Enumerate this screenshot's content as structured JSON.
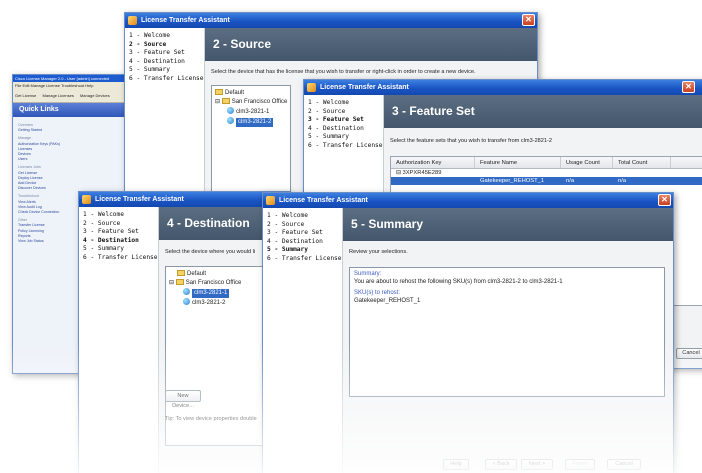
{
  "clm": {
    "title": "Cisco License Manager 2.0 - User [admin] connected",
    "menu": "File  Edit  Manage  License  Troubleshoot  Help",
    "toolbar": [
      "Get License",
      "Manage Licenses",
      "Manage Devices"
    ],
    "quick_links_title": "Quick Links",
    "links": [
      "Overview",
      "Getting Started",
      "Manage",
      "Authorization Keys (PAKs)",
      "Licenses",
      "Devices",
      "Users",
      "Licenses Jobs",
      "Get License",
      "Deploy License",
      "Add Device",
      "Discover Devices",
      "Troubleshoot",
      "View Alerts",
      "View Audit Log",
      "Check Device Connection",
      "Other",
      "Transfer License",
      "Policy Licensing",
      "Reports",
      "View Job Status"
    ]
  },
  "wizard_title": "License Transfer Assistant",
  "steps": [
    "1 - Welcome",
    "2 - Source",
    "3 - Feature Set",
    "4 - Destination",
    "5 - Summary",
    "6 - Transfer License"
  ],
  "source": {
    "heading": "2 - Source",
    "instruction": "Select the device that has the license that you wish to transfer or right-click in order to create a new device.",
    "tree": [
      "Default",
      "San Francisco Office",
      "clm3-2821-1",
      "clm3-2821-2"
    ]
  },
  "feature": {
    "heading": "3 - Feature Set",
    "instruction": "Select the feature sets that you wish to transfer from clm3-2821-2",
    "columns": [
      "Authorization Key",
      "Feature Name",
      "Usage Count",
      "Total Count"
    ],
    "group_key": "3XPXR45E289",
    "row": {
      "feature": "Gatekeeper_REHOST_1",
      "usage": "n/a",
      "total": "n/a"
    },
    "cancel": "Cancel"
  },
  "destination": {
    "heading": "4 - Destination",
    "instruction": "Select the device where you would li",
    "tree": [
      "Default",
      "San Francisco Office",
      "clm3-2821-1",
      "clm3-2821-2"
    ],
    "new_device": "New Device...",
    "tip": "Tip: To view device properties double"
  },
  "summary": {
    "heading": "5 - Summary",
    "instruction": "Review your selections.",
    "summary_label": "Summary:",
    "summary_text": "You are about to rehost the following SKU(s) from clm3-2821-2 to clm3-2821-1",
    "sku_label": "SKU(s) to rehost:",
    "sku_value": "Gatekeeper_REHOST_1",
    "buttons": {
      "help": "Help",
      "back": "< Back",
      "next": "Next >",
      "finish": "Finish",
      "cancel": "Cancel"
    }
  }
}
